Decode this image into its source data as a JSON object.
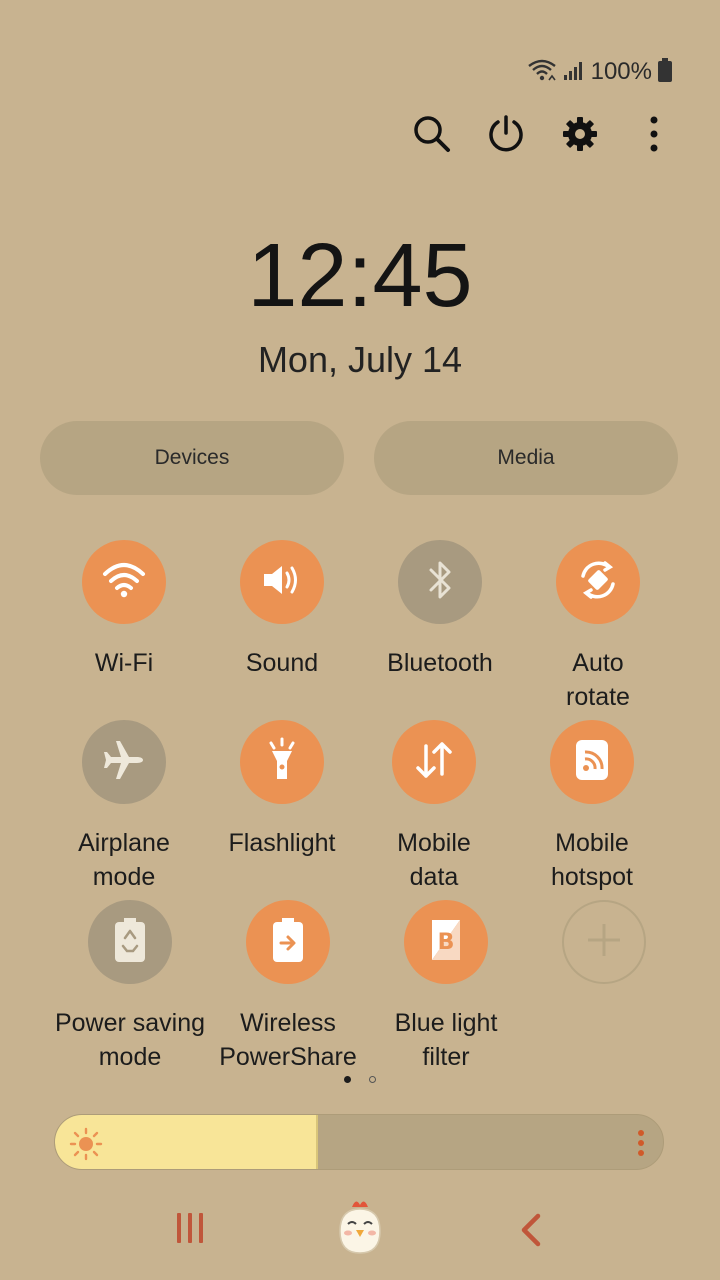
{
  "status_bar": {
    "battery_text": "100%",
    "icons": [
      "wifi-icon",
      "signal-icon",
      "battery-icon"
    ]
  },
  "top_actions": [
    "search-icon",
    "power-icon",
    "settings-icon",
    "more-vert-icon"
  ],
  "clock": {
    "time": "12:45",
    "date": "Mon, July 14"
  },
  "panels": {
    "devices": "Devices",
    "media": "Media"
  },
  "tiles": [
    {
      "label": "Wi-Fi",
      "icon": "wifi-icon",
      "state": "on"
    },
    {
      "label": "Sound",
      "icon": "sound-icon",
      "state": "on"
    },
    {
      "label": "Bluetooth",
      "icon": "bluetooth-icon",
      "state": "off"
    },
    {
      "label": "Auto\nrotate",
      "icon": "auto-rotate-icon",
      "state": "on"
    },
    {
      "label": "Airplane\nmode",
      "icon": "airplane-icon",
      "state": "off"
    },
    {
      "label": "Flashlight",
      "icon": "flashlight-icon",
      "state": "on"
    },
    {
      "label": "Mobile\ndata",
      "icon": "mobile-data-icon",
      "state": "on"
    },
    {
      "label": "Mobile\nhotspot",
      "icon": "hotspot-icon",
      "state": "on"
    },
    {
      "label": "Power saving\nmode",
      "icon": "power-saving-icon",
      "state": "off"
    },
    {
      "label": "Wireless\nPowerShare",
      "icon": "wireless-powershare-icon",
      "state": "on"
    },
    {
      "label": "Blue light\nfilter",
      "icon": "blue-light-filter-icon",
      "state": "on"
    },
    {
      "label": "",
      "icon": "add-icon",
      "state": "add"
    }
  ],
  "page_indicator": {
    "pages": 2,
    "current": 1
  },
  "brightness": {
    "level": 0.43
  },
  "nav_bar": [
    "recents-icon",
    "home-icon",
    "back-icon"
  ],
  "colors": {
    "background": "#c8b390",
    "accent": "#eb9253",
    "tile_off": "#a89a80",
    "pill": "#b6a583",
    "brightness_fill": "#f8e598",
    "nav_accent": "#c0563a"
  }
}
